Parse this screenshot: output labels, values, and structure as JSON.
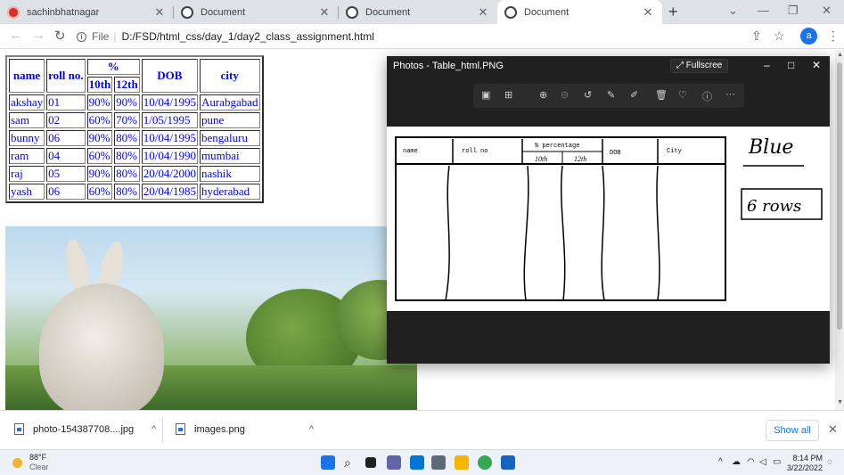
{
  "tabs": [
    {
      "title": "sachinbhatnagar",
      "icon": "red-badge-icon",
      "active": false
    },
    {
      "title": "Document",
      "icon": "globe-icon",
      "active": false
    },
    {
      "title": "Document",
      "icon": "globe-icon",
      "active": false
    },
    {
      "title": "Document",
      "icon": "globe-icon",
      "active": true
    }
  ],
  "address": {
    "scheme": "File",
    "url": "D:/FSD/html_css/day_1/day2_class_assignment.html"
  },
  "profile_initial": "a",
  "table": {
    "headers": {
      "name": "name",
      "roll": "roll no.",
      "percent": "%",
      "tenth": "10th",
      "twelfth": "12th",
      "dob": "DOB",
      "city": "city"
    },
    "rows": [
      [
        "akshay",
        "01",
        "90%",
        "90%",
        "10/04/1995",
        "Aurabgabad"
      ],
      [
        "sam",
        "02",
        "60%",
        "70%",
        "1/05/1995",
        "pune"
      ],
      [
        "bunny",
        "06",
        "90%",
        "80%",
        "10/04/1995",
        "bengaluru"
      ],
      [
        "ram",
        "04",
        "60%",
        "80%",
        "10/04/1990",
        "mumbai"
      ],
      [
        "raj",
        "05",
        "90%",
        "80%",
        "20/04/2000",
        "nashik"
      ],
      [
        "yash",
        "06",
        "60%",
        "80%",
        "20/04/1985",
        "hyderabad"
      ]
    ]
  },
  "photos": {
    "title": "Photos - Table_html.PNG",
    "fullscreen_label": "Fullscree",
    "sketch": {
      "col_name": "name",
      "col_roll": "roll no",
      "col_percent": "% percentage",
      "col_tenth": "10th",
      "col_twelfth": "12th",
      "col_dob": "DOB",
      "col_city": "City",
      "note_color": "Blue",
      "note_rows": "6 rows"
    }
  },
  "downloads": {
    "items": [
      "photo-154387708....jpg",
      "images.png"
    ],
    "show_all": "Show all"
  },
  "taskbar": {
    "temperature": "88°F",
    "condition": "Clear",
    "time": "8:14 PM",
    "date": "3/22/2022"
  },
  "colors": {
    "table_text": "#0000ff",
    "accent": "#1a73e8",
    "tab_strip": "#dee1e6"
  }
}
